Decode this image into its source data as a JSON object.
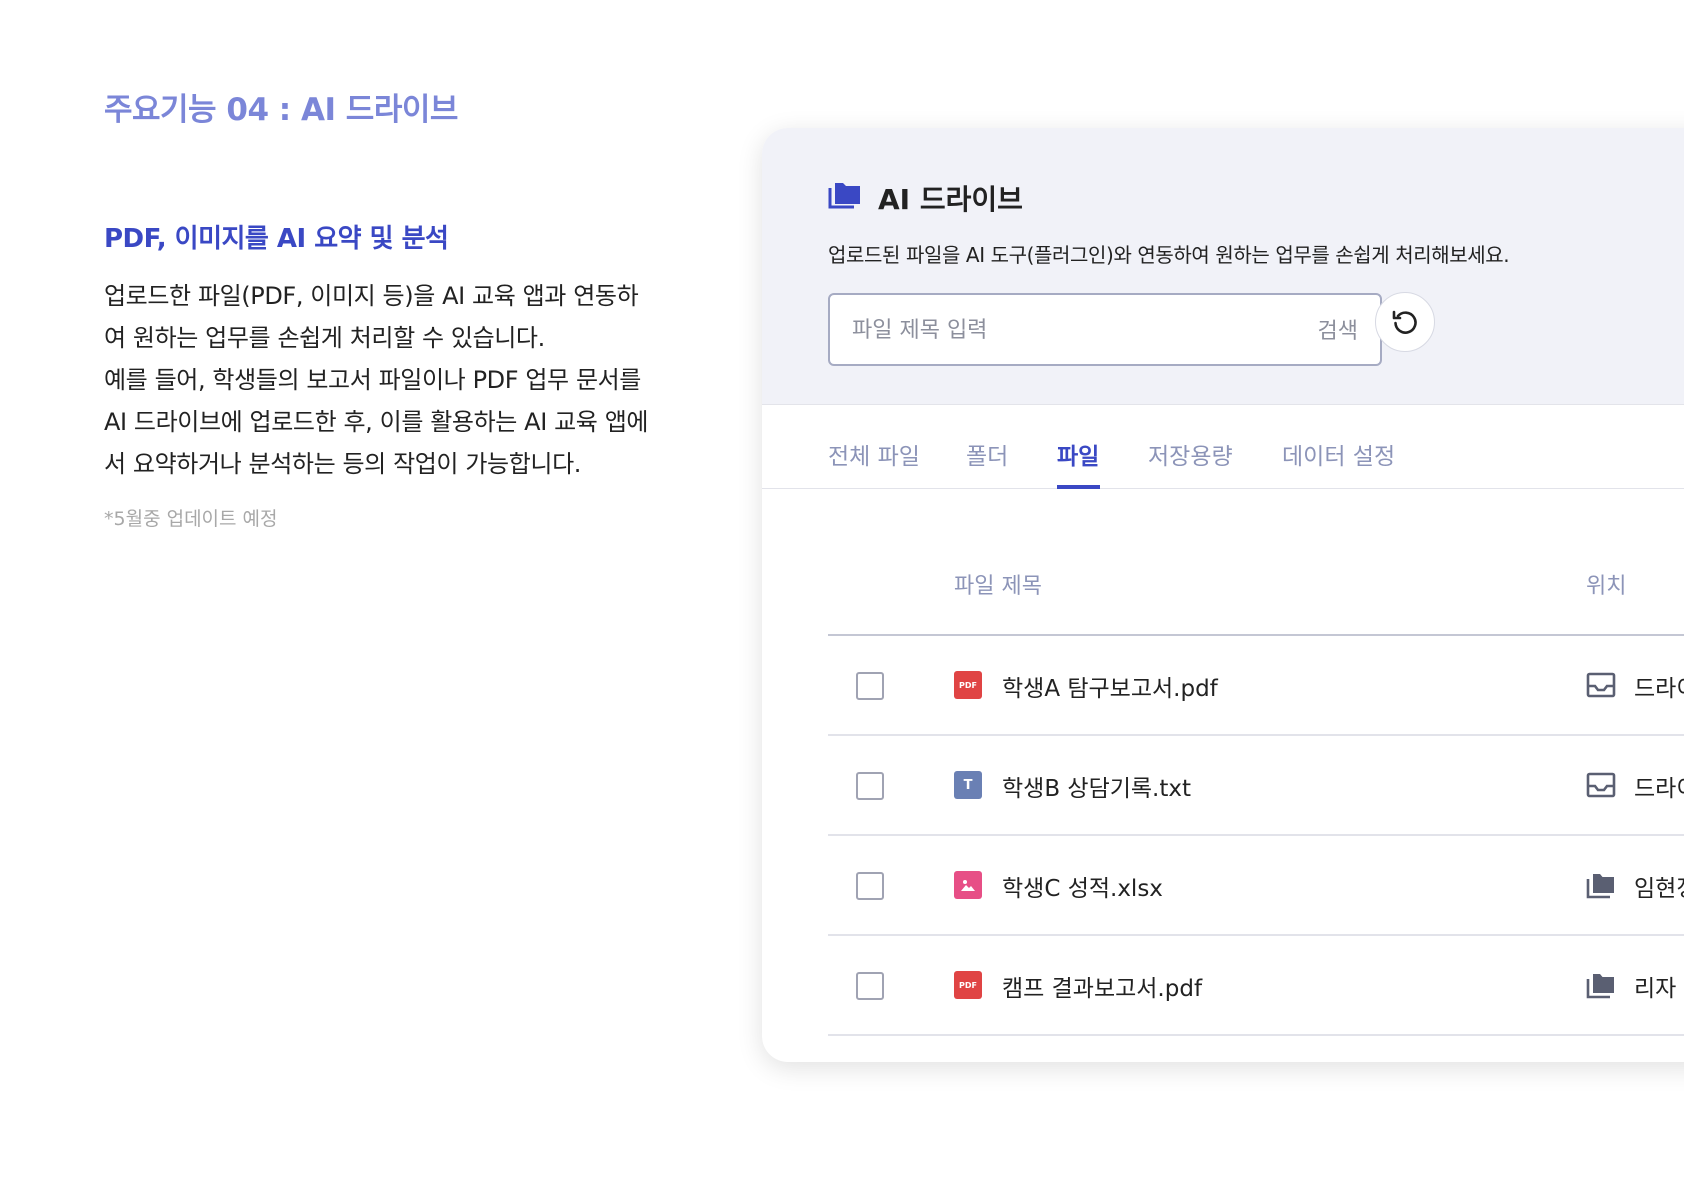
{
  "section_title": "주요기능 04 : AI 드라이브",
  "feature": {
    "heading": "PDF, 이미지를 AI 요약 및 분석",
    "lines": [
      "업로드한 파일(PDF, 이미지 등)을 AI 교육 앱과 연동하",
      "여 원하는 업무를 손쉽게 처리할 수 있습니다.",
      "예를 들어, 학생들의 보고서 파일이나 PDF 업무 문서를",
      "AI 드라이브에 업로드한 후, 이를 활용하는 AI 교육 앱에",
      "서 요약하거나 분석하는 등의 작업이 가능합니다."
    ],
    "note": "*5월중 업데이트 예정"
  },
  "drive": {
    "title": "AI 드라이브",
    "subtitle": "업로드된 파일을 AI 도구(플러그인)와 연동하여 원하는 업무를 손쉽게 처리해보세요.",
    "search_placeholder": "파일 제목 입력",
    "search_button": "검색",
    "tabs": [
      {
        "label": "전체 파일",
        "active": false
      },
      {
        "label": "폴더",
        "active": false
      },
      {
        "label": "파일",
        "active": true
      },
      {
        "label": "저장용량",
        "active": false
      },
      {
        "label": "데이터 설정",
        "active": false
      }
    ],
    "columns": {
      "title": "파일 제목",
      "location": "위치"
    },
    "rows": [
      {
        "icon": "pdf-icon",
        "icon_label": "PDF",
        "name": "학생A 탐구보고서.pdf",
        "location_icon": "inbox-icon",
        "location": "드라이브"
      },
      {
        "icon": "txt-icon",
        "icon_label": "T",
        "name": "학생B 상담기록.txt",
        "location_icon": "inbox-icon",
        "location": "드라이브"
      },
      {
        "icon": "image-icon",
        "icon_label": "",
        "name": "학생C 성적.xlsx",
        "location_icon": "folder-icon",
        "location": "임현정"
      },
      {
        "icon": "pdf-icon",
        "icon_label": "PDF",
        "name": "캠프 결과보고서.pdf",
        "location_icon": "folder-icon",
        "location": "리자"
      }
    ]
  },
  "colors": {
    "section_title": "#7b86d8",
    "accent": "#3a48c4",
    "panel_header_bg": "#f1f2f8",
    "pdf": "#e04444",
    "txt": "#6a80b4",
    "image": "#e74f86"
  }
}
